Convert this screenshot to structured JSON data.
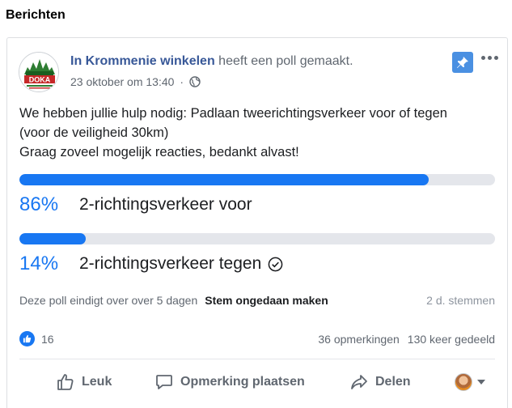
{
  "section": {
    "title": "Berichten"
  },
  "post": {
    "author": "In Krommenie winkelen",
    "action": "heeft een poll gemaakt.",
    "timestamp": "23 oktober om 13:40",
    "separator": "·",
    "logo_text": "DOKA",
    "text_lines": [
      "We hebben jullie hulp nodig: Padlaan tweerichtingsverkeer voor of tegen",
      "(voor de veiligheid 30km)",
      "Graag zoveel mogelijk reacties, bedankt alvast!"
    ]
  },
  "poll": {
    "options": [
      {
        "percent_label": "86%",
        "fraction": 0.86,
        "label": "2-richtingsverkeer voor",
        "voted": false
      },
      {
        "percent_label": "14%",
        "fraction": 0.14,
        "label": "2-richtingsverkeer tegen",
        "voted": true
      }
    ],
    "footer": {
      "ends_text": "Deze poll eindigt over over 5 dagen",
      "undo_label": "Stem ongedaan maken",
      "votes_text": "2 d. stemmen"
    }
  },
  "stats": {
    "likes": "16",
    "comments": "36 opmerkingen",
    "shares": "130 keer gedeeld"
  },
  "actions": {
    "like": "Leuk",
    "comment": "Opmerking plaatsen",
    "share": "Delen"
  },
  "colors": {
    "accent": "#1877f2",
    "author_link": "#385898",
    "pin_button": "#4a90e2"
  },
  "icons": {
    "globe": "globe-icon",
    "pin": "pin-icon",
    "more": "more-icon",
    "check": "check-circle-icon",
    "like": "thumbs-up-icon",
    "comment": "comment-icon",
    "share": "share-icon"
  }
}
